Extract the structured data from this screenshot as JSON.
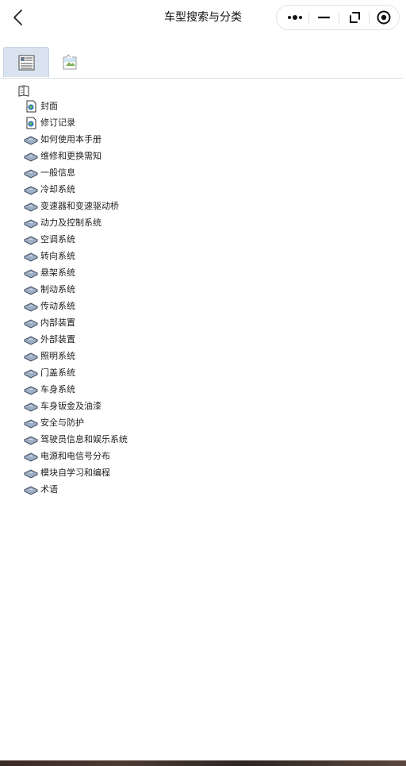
{
  "header": {
    "title": "车型搜索与分类"
  },
  "tree": {
    "items": [
      {
        "label": "封面",
        "icon": "page-icon"
      },
      {
        "label": "修订记录",
        "icon": "page-icon"
      },
      {
        "label": "如何使用本手册",
        "icon": "book-icon"
      },
      {
        "label": "维修和更换需知",
        "icon": "book-icon"
      },
      {
        "label": "一般信息",
        "icon": "book-icon"
      },
      {
        "label": "冷却系统",
        "icon": "book-icon"
      },
      {
        "label": "变速器和变速驱动桥",
        "icon": "book-icon"
      },
      {
        "label": "动力及控制系统",
        "icon": "book-icon"
      },
      {
        "label": "空调系统",
        "icon": "book-icon"
      },
      {
        "label": "转向系统",
        "icon": "book-icon"
      },
      {
        "label": "悬架系统",
        "icon": "book-icon"
      },
      {
        "label": "制动系统",
        "icon": "book-icon"
      },
      {
        "label": "传动系统",
        "icon": "book-icon"
      },
      {
        "label": "内部装置",
        "icon": "book-icon"
      },
      {
        "label": "外部装置",
        "icon": "book-icon"
      },
      {
        "label": "照明系统",
        "icon": "book-icon"
      },
      {
        "label": "门盖系统",
        "icon": "book-icon"
      },
      {
        "label": "车身系统",
        "icon": "book-icon"
      },
      {
        "label": "车身钣金及油漆",
        "icon": "book-icon"
      },
      {
        "label": "安全与防护",
        "icon": "book-icon"
      },
      {
        "label": "驾驶员信息和娱乐系统",
        "icon": "book-icon"
      },
      {
        "label": "电源和电信号分布",
        "icon": "book-icon"
      },
      {
        "label": "模块自学习和编程",
        "icon": "book-icon"
      },
      {
        "label": "术语",
        "icon": "book-icon"
      }
    ]
  }
}
